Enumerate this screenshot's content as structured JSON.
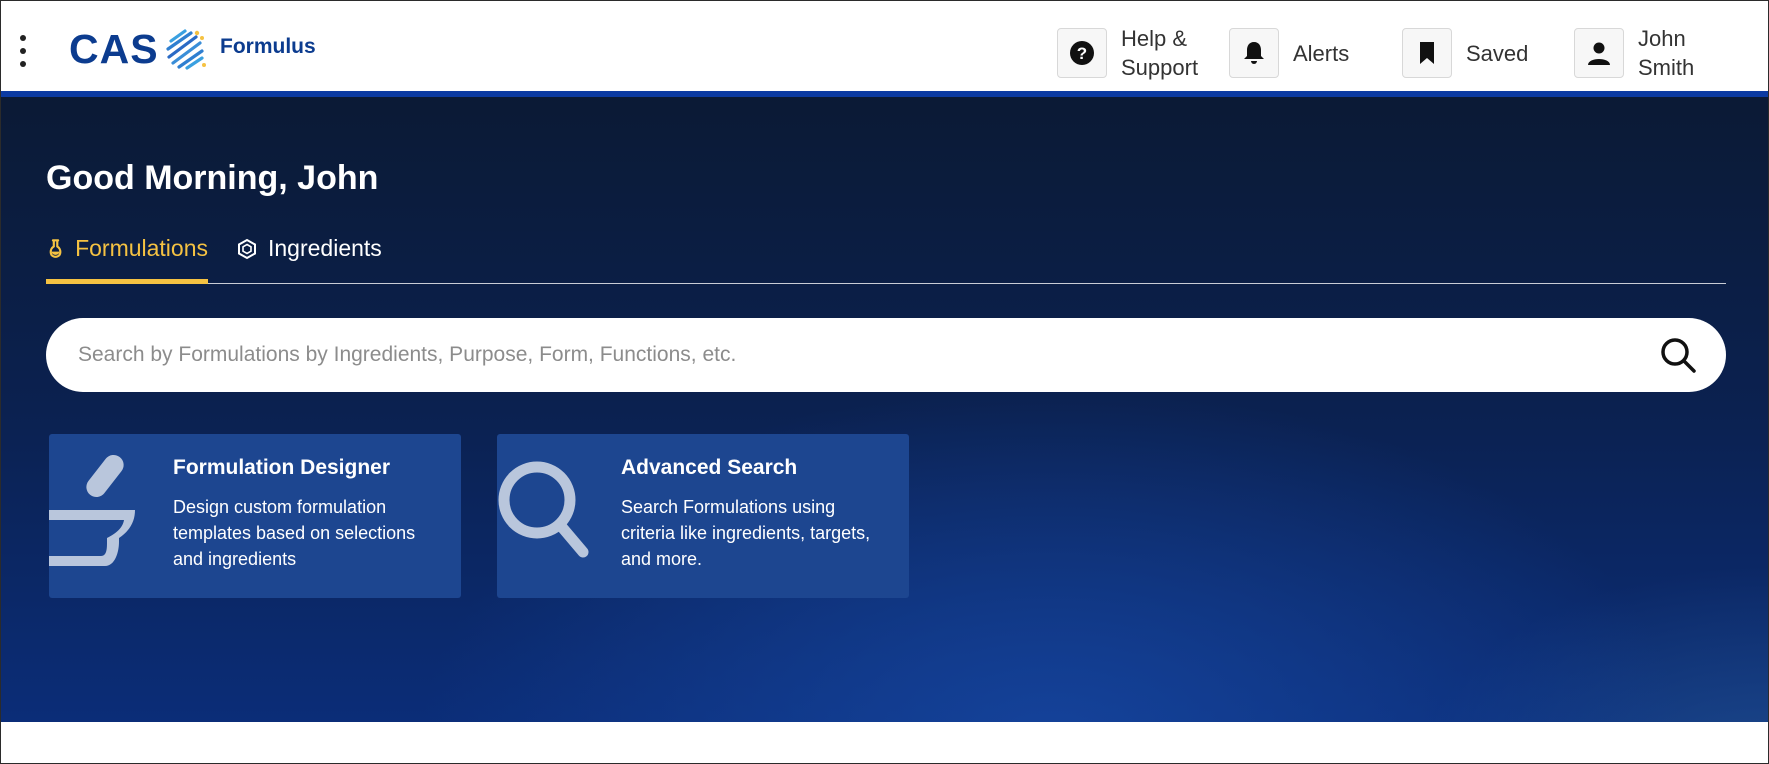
{
  "header": {
    "logo_text": "CAS",
    "product_name": "Formulus",
    "actions": [
      {
        "label": "Help &\nSupport",
        "icon": "help-icon"
      },
      {
        "label": "Alerts",
        "icon": "bell-icon"
      },
      {
        "label": "Saved",
        "icon": "bookmark-icon"
      },
      {
        "label": "John\nSmith",
        "icon": "user-icon"
      }
    ],
    "accent_color": "#0b3aa2",
    "brand_color": "#0c3c8f"
  },
  "hero": {
    "greeting": "Good Morning, John",
    "tabs": [
      {
        "label": "Formulations",
        "icon": "flask-icon",
        "active": true
      },
      {
        "label": "Ingredients",
        "icon": "hexagon-icon",
        "active": false
      }
    ],
    "tab_active_color": "#f5c242",
    "search": {
      "placeholder": "Search by Formulations by Ingredients, Purpose, Form, Functions, etc.",
      "value": ""
    },
    "cards": [
      {
        "title": "Formulation Designer",
        "description": "Design custom formulation templates based on selections and ingredients",
        "icon": "mortar-pestle-icon"
      },
      {
        "title": "Advanced Search",
        "description": "Search Formulations using criteria like ingredients, targets, and more.",
        "icon": "magnifier-icon"
      }
    ]
  }
}
